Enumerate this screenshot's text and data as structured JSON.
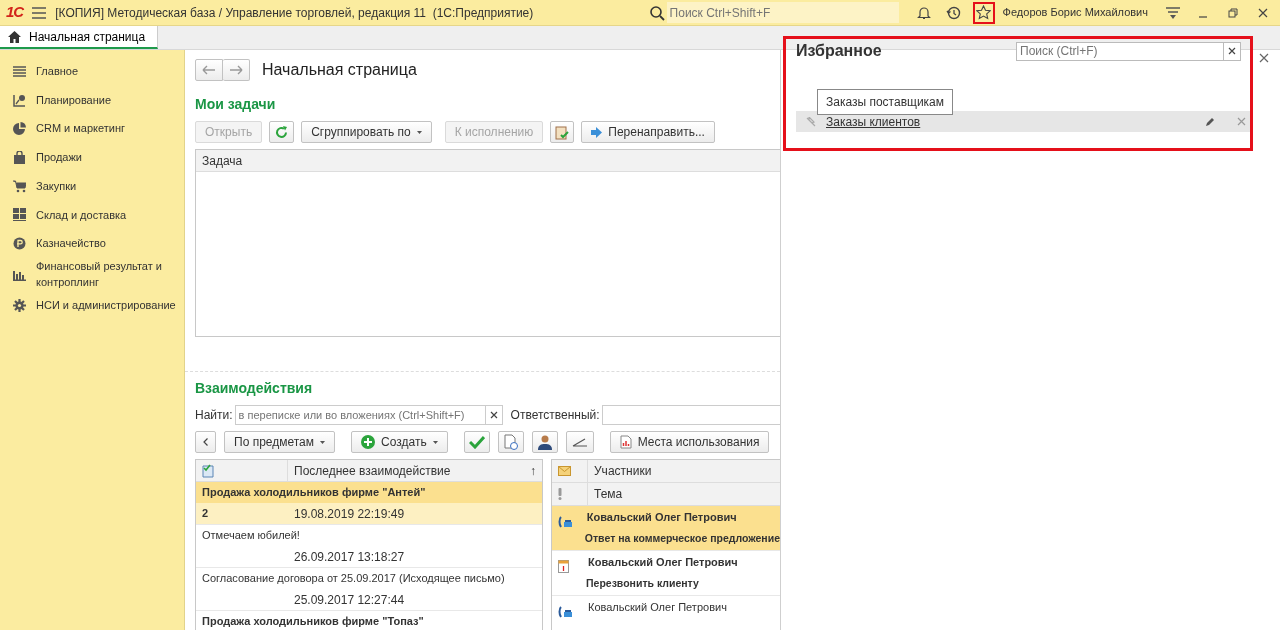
{
  "app_bar": {
    "logo": "1С",
    "title": "[КОПИЯ] Методическая база / Управление торговлей, редакция 11  (1С:Предприятие)",
    "search": {
      "placeholder": "Поиск Ctrl+Shift+F"
    },
    "favorites_highlighted": true,
    "user": "Федоров Борис Михайлович"
  },
  "tabs": [
    {
      "label": "Начальная страница",
      "selected": true
    }
  ],
  "sidebar": {
    "items": [
      {
        "label": "Главное",
        "kind": "list"
      },
      {
        "label": "Планирование",
        "kind": "plan"
      },
      {
        "label": "CRM и маркетинг",
        "kind": "pie"
      },
      {
        "label": "Продажи",
        "kind": "bag"
      },
      {
        "label": "Закупки",
        "kind": "cart"
      },
      {
        "label": "Склад и доставка",
        "kind": "grid"
      },
      {
        "label": "Казначейство",
        "kind": "coin"
      },
      {
        "label": "Финансовый результат и контроплинг",
        "kind": "bars"
      },
      {
        "label": "НСИ и администрирование",
        "kind": "gear"
      }
    ]
  },
  "page": {
    "title": "Начальная страница"
  },
  "tasks": {
    "title": "Мои задачи",
    "buttons": [
      {
        "kind": "text",
        "label": "Открыть",
        "disabled": true
      },
      {
        "kind": "refresh",
        "disabled": false
      },
      {
        "kind": "dropdown",
        "label": "Сгруппировать по",
        "disabled": false
      },
      {
        "kind": "text",
        "label": "К исполнению",
        "disabled": true
      },
      {
        "kind": "clipboard",
        "disabled": false
      },
      {
        "kind": "forward",
        "label": "Перенаправить...",
        "disabled": false
      }
    ],
    "columns": [
      "Задача"
    ]
  },
  "interactions": {
    "title": "Взаимодействия",
    "find_label": "Найти:",
    "find_placeholder": "в переписке или во вложениях (Ctrl+Shift+F)",
    "responsible_label": "Ответственный:",
    "buttons": [
      {
        "kind": "back"
      },
      {
        "kind": "dropdown",
        "label": "По предметам"
      },
      {
        "kind": "create",
        "label": "Создать"
      },
      {
        "kind": "check"
      },
      {
        "kind": "document"
      },
      {
        "kind": "person"
      },
      {
        "kind": "angle"
      },
      {
        "kind": "report",
        "label": "Места использования"
      }
    ],
    "subjects": {
      "columns": [
        "Последнее взаимодействие"
      ],
      "sort_mark": "↑",
      "rows": [
        {
          "subject": "Продажа холодильников фирме \"Антей\"",
          "count": "2",
          "date": "19.08.2019 22:19:49",
          "unread": true,
          "selected": true
        },
        {
          "subject": "Отмечаем юбилей!",
          "date": "26.09.2017 13:18:27",
          "unread": false,
          "selected": false
        },
        {
          "subject": "Согласование договора от 25.09.2017 (Исходящее письмо)",
          "date": "25.09.2017 12:27:44",
          "unread": false,
          "selected": false
        },
        {
          "subject": "Продажа холодильников фирме \"Топаз\"",
          "unread": true,
          "selected": false
        }
      ]
    },
    "messages": {
      "columns": [
        "Участники",
        "Тема"
      ],
      "rows": [
        {
          "kind": "call",
          "participants": "Ковальский Олег Петрович",
          "topic": "Ответ на коммерческое предложение",
          "unread": true,
          "selected": true
        },
        {
          "kind": "event",
          "participants": "Ковальский Олег Петрович",
          "topic": "Перезвонить клиенту",
          "unread": true,
          "selected": false
        },
        {
          "kind": "call",
          "participants": "Ковальский Олег Петрович",
          "unread": false,
          "selected": false
        }
      ]
    }
  },
  "favorites": {
    "title": "Избранное",
    "highlighted": true,
    "search": {
      "placeholder": "Поиск (Ctrl+F)"
    },
    "tooltip": "Заказы поставщикам",
    "items": [
      {
        "label": "Заказы клиентов",
        "selected": true
      }
    ]
  }
}
